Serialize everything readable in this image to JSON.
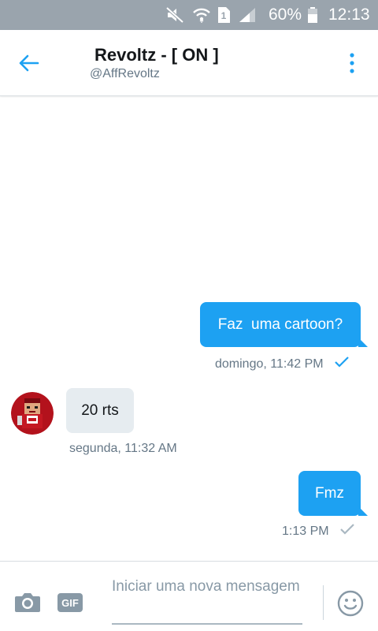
{
  "status_bar": {
    "battery_percent": "60%",
    "time": "12:13",
    "sim_slot": "1",
    "icons": [
      "mute-icon",
      "wifi-icon",
      "sim-icon",
      "signal-icon",
      "battery-icon"
    ]
  },
  "header": {
    "title": "Revoltz - [ ON ]",
    "handle": "@AffRevoltz",
    "back_icon": "back-arrow-icon",
    "more_icon": "more-vertical-icon"
  },
  "messages": [
    {
      "direction": "outgoing",
      "text": "Faz  uma cartoon?",
      "meta": "domingo, 11:42 PM",
      "status": "read"
    },
    {
      "direction": "incoming",
      "text": "20 rts",
      "meta": "segunda, 11:32 AM"
    },
    {
      "direction": "outgoing",
      "text": "Fmz",
      "meta": "1:13 PM",
      "status": "sent"
    }
  ],
  "composer": {
    "placeholder": "Iniciar uma nova mensagem",
    "gif_label": "GIF",
    "camera_icon": "camera-icon",
    "emoji_icon": "emoji-icon"
  },
  "colors": {
    "accent": "#1da1f2",
    "status_bar": "#9aa4ad",
    "incoming_bubble": "#e6ecf0",
    "muted_text": "#657786"
  }
}
